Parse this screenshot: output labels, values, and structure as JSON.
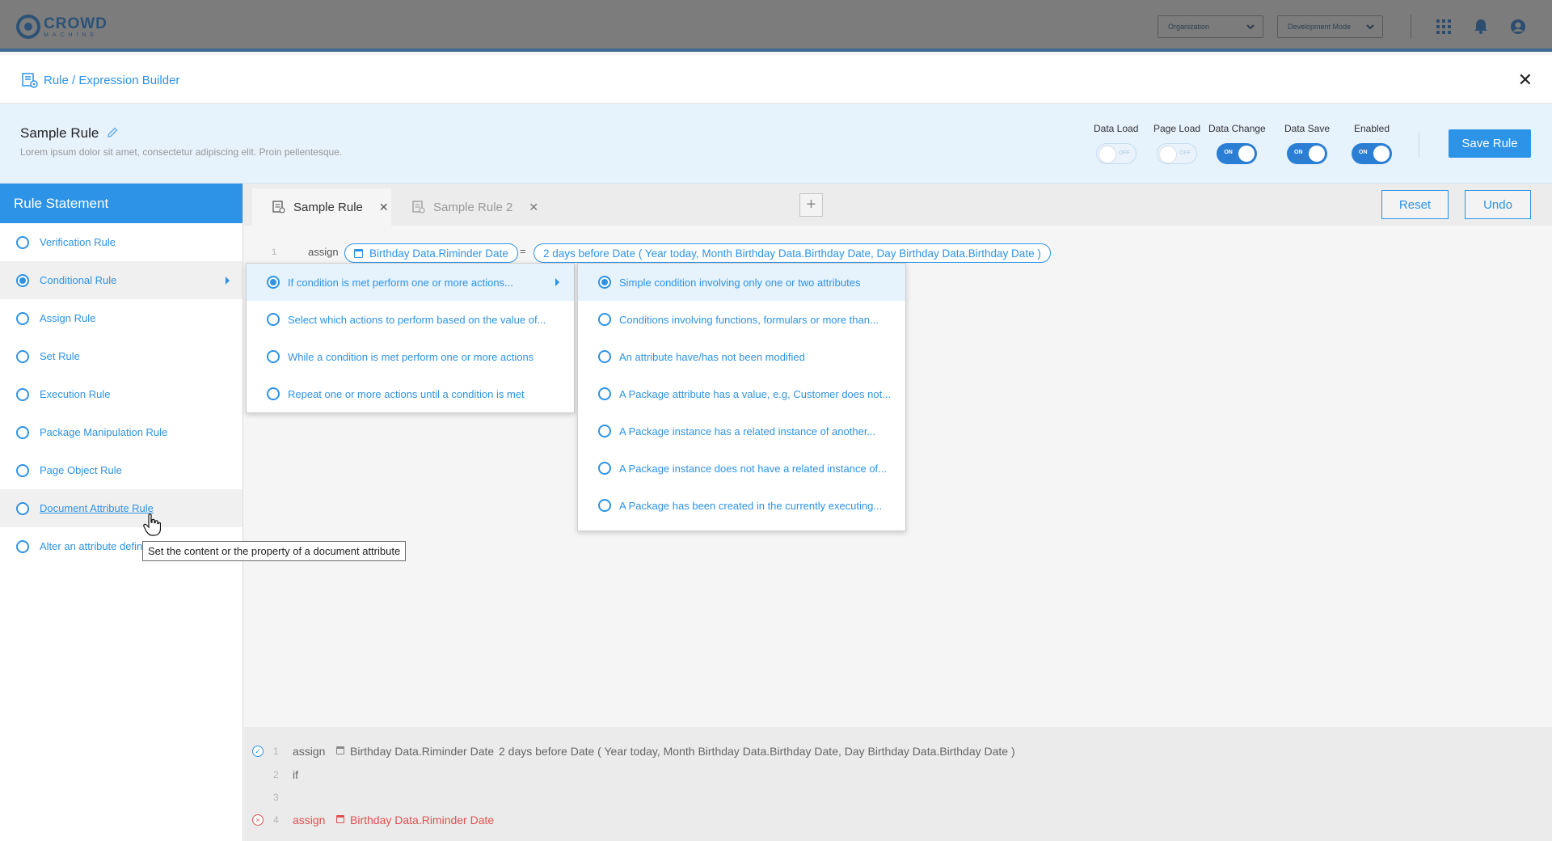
{
  "colors": {
    "accent": "#2d93e6",
    "topbar": "#7c7c7c",
    "header_bg": "#e6f2fc",
    "error": "#e05252"
  },
  "topbar": {
    "logo_word": "CROWD",
    "logo_sub": "MACHINE",
    "organization_select": "Organization",
    "mode_select": "Development Mode",
    "icons": [
      "apps-grid-icon",
      "bell-icon",
      "user-account-icon"
    ]
  },
  "breadcrumb": {
    "text": "Rule / Expression Builder",
    "close": "✕"
  },
  "rule": {
    "title": "Sample Rule",
    "description": "Lorem ipsum dolor sit amet, consectetur adipiscing elit. Proin pellentesque."
  },
  "toggles": [
    {
      "label": "Data Load",
      "state": "OFF"
    },
    {
      "label": "Page Load",
      "state": "OFF"
    },
    {
      "label": "Data Change",
      "state": "ON"
    },
    {
      "label": "Data Save",
      "state": "ON"
    },
    {
      "label": "Enabled",
      "state": "ON"
    }
  ],
  "save_button": "Save Rule",
  "left_panel": {
    "title": "Rule Statement",
    "items": [
      {
        "label": "Verification Rule"
      },
      {
        "label": "Conditional Rule",
        "selected": true
      },
      {
        "label": "Assign Rule"
      },
      {
        "label": "Set Rule"
      },
      {
        "label": "Execution Rule"
      },
      {
        "label": "Package Manipulation Rule"
      },
      {
        "label": "Page Object Rule"
      },
      {
        "label": "Document Attribute Rule",
        "hovered": true
      },
      {
        "label": "Alter an attribute defin"
      }
    ]
  },
  "tabs": [
    {
      "label": "Sample Rule",
      "active": true
    },
    {
      "label": "Sample Rule 2",
      "active": false
    }
  ],
  "tab_add": "+",
  "reset_button": "Reset",
  "undo_button": "Undo",
  "editor": {
    "line1": {
      "num": "1",
      "keyword": "assign",
      "target": "Birthday Data.Riminder Date",
      "equals": "=",
      "expression": "2 days before Date ( Year today, Month Birthday Data.Birthday Date, Day Birthday Data.Birthday Date )"
    }
  },
  "submenu1": [
    {
      "label": "If condition is met perform one or more actions...",
      "selected": true
    },
    {
      "label": "Select which actions to perform based on the value of..."
    },
    {
      "label": "While a condition is met perform one or more actions"
    },
    {
      "label": "Repeat one or more actions until a condition is met"
    }
  ],
  "submenu2": [
    {
      "label": "Simple condition involving only one or two attributes",
      "selected": true
    },
    {
      "label": "Conditions involving functions, formulars or more than..."
    },
    {
      "label": "An attribute have/has not been modified"
    },
    {
      "label": "A Package attribute has a value, e.g, Customer does not..."
    },
    {
      "label": "A Package instance has a related instance of another..."
    },
    {
      "label": "A Package instance does not have a related instance of..."
    },
    {
      "label": "A Package has been created in the currently executing..."
    }
  ],
  "tooltip": "Set the content or the property of a document attribute",
  "preview": [
    {
      "num": "1",
      "status": "ok",
      "keyword": "assign",
      "target": "Birthday Data.Riminder Date",
      "expression": "2 days before Date ( Year today, Month Birthday Data.Birthday Date, Day Birthday Data.Birthday Date )"
    },
    {
      "num": "2",
      "status": "",
      "keyword": "if"
    },
    {
      "num": "3",
      "status": ""
    },
    {
      "num": "4",
      "status": "error",
      "keyword": "assign",
      "target": "Birthday Data.Riminder Date"
    }
  ],
  "status_marks": {
    "ok": "✓",
    "error": "×"
  }
}
